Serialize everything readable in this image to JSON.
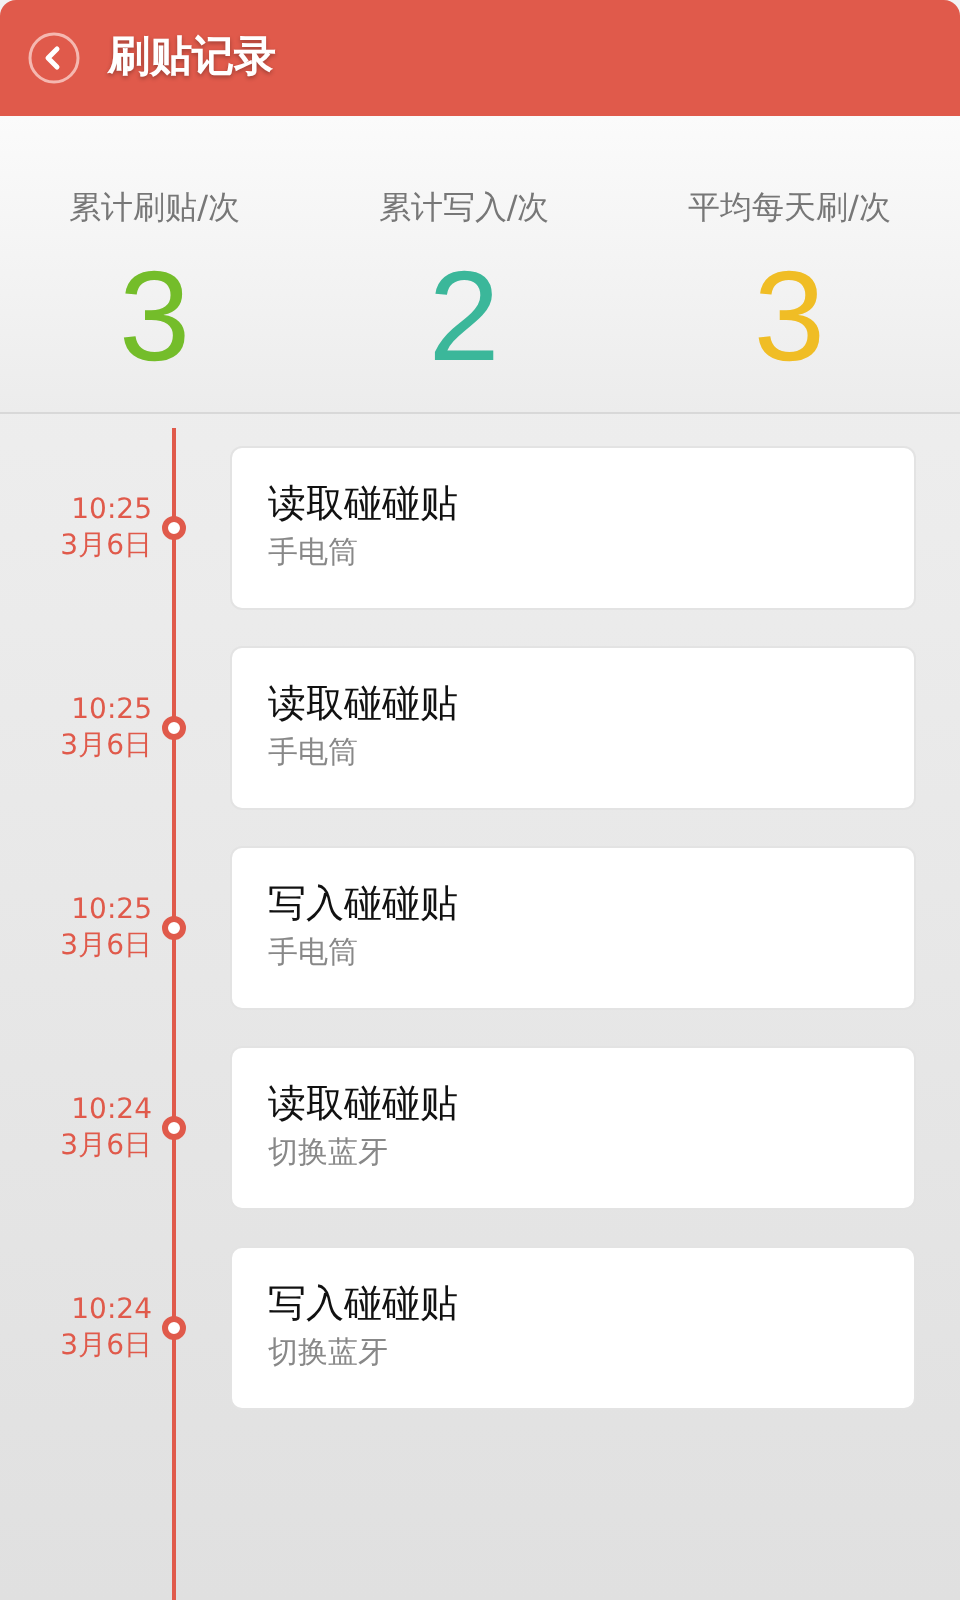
{
  "header": {
    "title": "刷贴记录"
  },
  "stats": [
    {
      "label": "累计刷贴/次",
      "value": "3",
      "color": "#74bd2a"
    },
    {
      "label": "累计写入/次",
      "value": "2",
      "color": "#3bb79a"
    },
    {
      "label": "平均每天刷/次",
      "value": "3",
      "color": "#f0bd25"
    }
  ],
  "records": [
    {
      "time": "10:25",
      "date": "3月6日",
      "action": "读取碰碰贴",
      "detail": "手电筒"
    },
    {
      "time": "10:25",
      "date": "3月6日",
      "action": "读取碰碰贴",
      "detail": "手电筒"
    },
    {
      "time": "10:25",
      "date": "3月6日",
      "action": "写入碰碰贴",
      "detail": "手电筒"
    },
    {
      "time": "10:24",
      "date": "3月6日",
      "action": "读取碰碰贴",
      "detail": "切换蓝牙"
    },
    {
      "time": "10:24",
      "date": "3月6日",
      "action": "写入碰碰贴",
      "detail": "切换蓝牙"
    }
  ]
}
